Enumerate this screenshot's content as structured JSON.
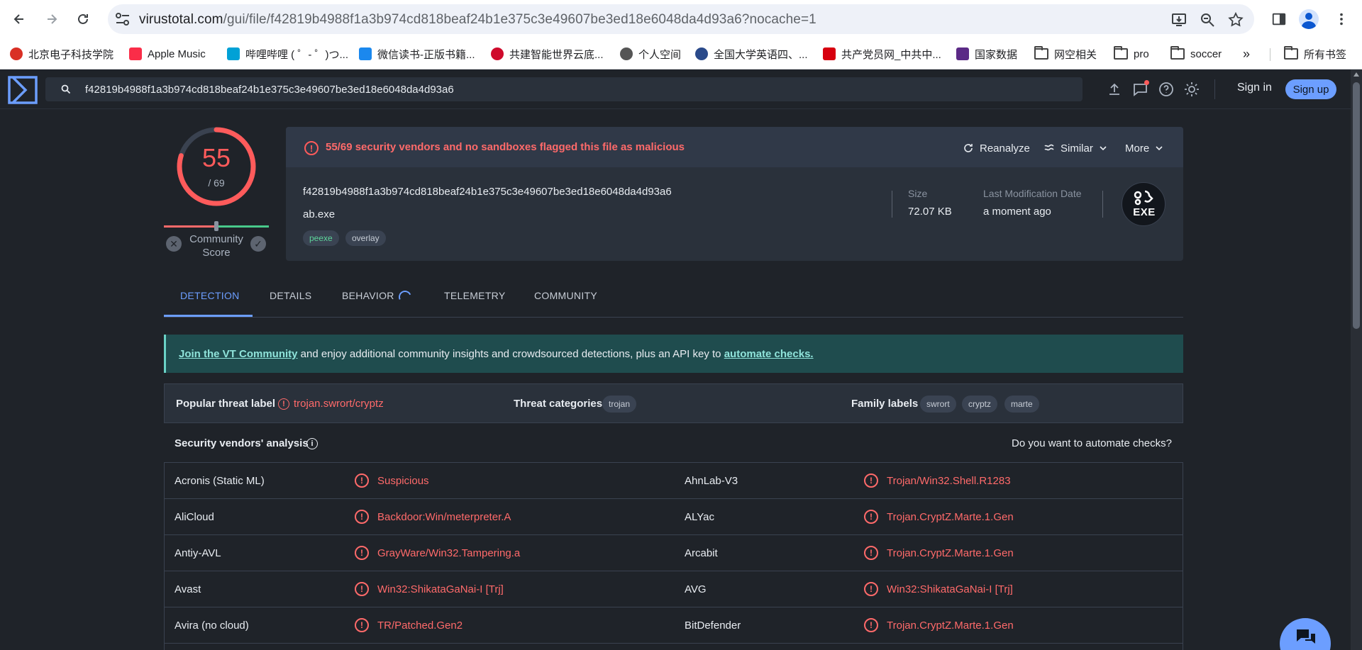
{
  "browser": {
    "url_host": "virustotal.com",
    "url_path": "/gui/file/f42819b4988f1a3b974cd818beaf24b1e375c3e49607be3ed18e6048da4d93a6?nocache=1",
    "bookmarks": [
      {
        "label": "北京电子科技学院",
        "color": "#d93025"
      },
      {
        "label": "Apple Music",
        "color": "#fa2d48"
      },
      {
        "label": "哔哩哔哩 ( ゜- ゜)つ...",
        "color": "#00a1d6"
      },
      {
        "label": "微信读书-正版书籍...",
        "color": "#1b88ee"
      },
      {
        "label": "共建智能世界云底...",
        "color": "#cf0a2c"
      },
      {
        "label": "个人空间",
        "color": "#555555"
      },
      {
        "label": "全国大学英语四、...",
        "color": "#2a4a8a"
      },
      {
        "label": "共产党员网_中共中...",
        "color": "#d7000f"
      },
      {
        "label": "国家数据",
        "color": "#5b2a86"
      },
      {
        "label": "网空相关",
        "color": ""
      },
      {
        "label": "pro",
        "color": ""
      },
      {
        "label": "soccer",
        "color": ""
      }
    ],
    "more_bookmarks": "»",
    "all_bookmarks": "所有书签"
  },
  "header": {
    "search_value": "f42819b4988f1a3b974cd818beaf24b1e375c3e49607be3ed18e6048da4d93a6",
    "signin": "Sign in",
    "signup": "Sign up"
  },
  "score": {
    "detections": "55",
    "total": "/ 69",
    "fraction": 0.797,
    "community_label": "Community Score"
  },
  "file": {
    "alert": "55/69 security vendors and no sandboxes flagged this file as malicious",
    "reanalyze": "Reanalyze",
    "similar": "Similar",
    "more": "More",
    "hash": "f42819b4988f1a3b974cd818beaf24b1e375c3e49607be3ed18e6048da4d93a6",
    "name": "ab.exe",
    "tags": [
      "peexe",
      "overlay"
    ],
    "size_label": "Size",
    "size_value": "72.07 KB",
    "lastmod_label": "Last Modification Date",
    "lastmod_value": "a moment ago",
    "type_badge": "EXE"
  },
  "tabs": [
    "DETECTION",
    "DETAILS",
    "BEHAVIOR",
    "TELEMETRY",
    "COMMUNITY"
  ],
  "banner": {
    "link1": "Join the VT Community",
    "middle": " and enjoy additional community insights and crowdsourced detections, plus an API key to ",
    "link2": "automate checks."
  },
  "threat": {
    "popular_label": "Popular threat label",
    "popular_value": "trojan.swrort/cryptz",
    "categories_label": "Threat categories",
    "categories": [
      "trojan"
    ],
    "family_label": "Family labels",
    "families": [
      "swrort",
      "cryptz",
      "marte"
    ]
  },
  "vendors": {
    "title": "Security vendors' analysis",
    "automate": "Do you want to automate checks?",
    "rows": [
      {
        "left": "Acronis (Static ML)",
        "left_res": "Suspicious",
        "right": "AhnLab-V3",
        "right_res": "Trojan/Win32.Shell.R1283"
      },
      {
        "left": "AliCloud",
        "left_res": "Backdoor:Win/meterpreter.A",
        "right": "ALYac",
        "right_res": "Trojan.CryptZ.Marte.1.Gen"
      },
      {
        "left": "Antiy-AVL",
        "left_res": "GrayWare/Win32.Tampering.a",
        "right": "Arcabit",
        "right_res": "Trojan.CryptZ.Marte.1.Gen"
      },
      {
        "left": "Avast",
        "left_res": "Win32:ShikataGaNai-I [Trj]",
        "right": "AVG",
        "right_res": "Win32:ShikataGaNai-I [Trj]"
      },
      {
        "left": "Avira (no cloud)",
        "left_res": "TR/Patched.Gen2",
        "right": "BitDefender",
        "right_res": "Trojan.CryptZ.Marte.1.Gen"
      }
    ]
  },
  "colors": {
    "accent": "#6c9eff",
    "malicious": "#ff5b5b",
    "background": "#1f2329"
  }
}
